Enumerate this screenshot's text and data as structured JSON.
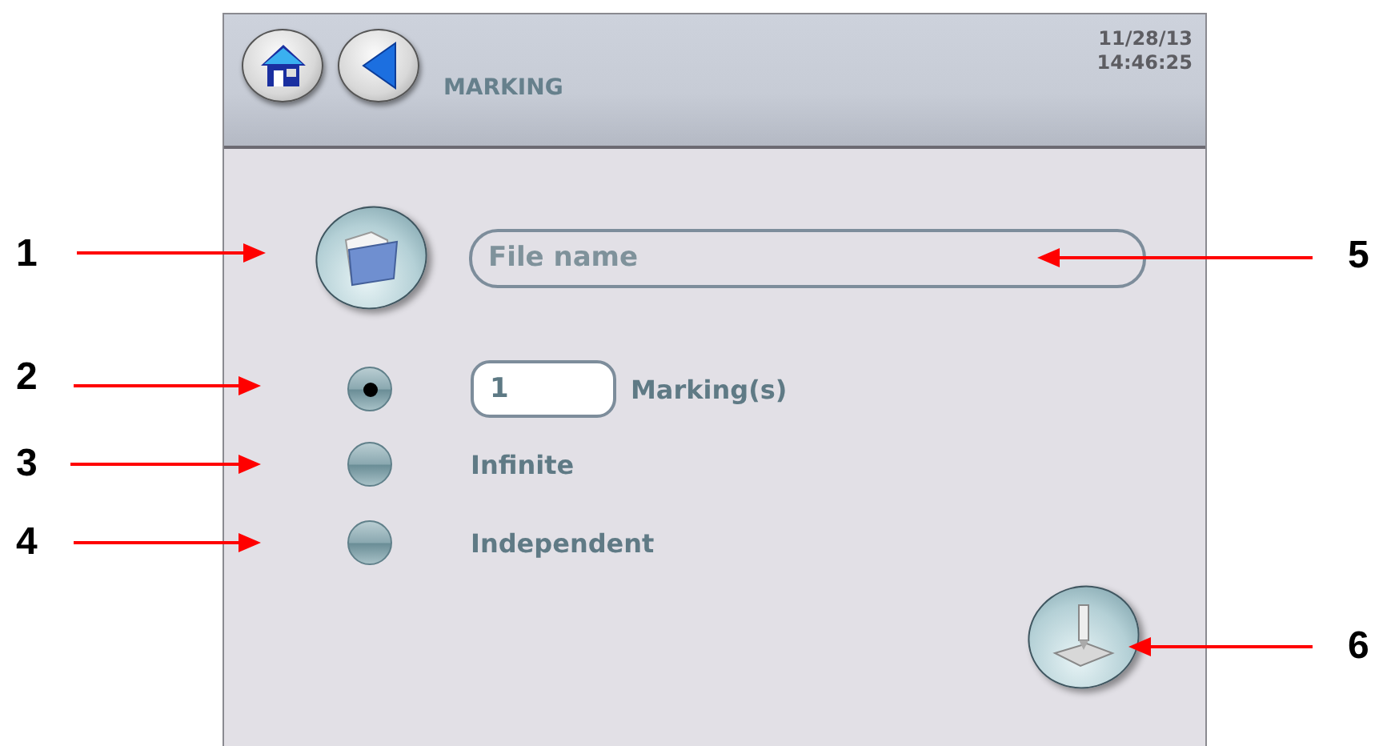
{
  "header": {
    "title": "MARKING",
    "date": "11/28/13",
    "time": "14:46:25"
  },
  "file_field": {
    "placeholder": "File name"
  },
  "modes": [
    {
      "kind": "count",
      "selected": true,
      "value": "1",
      "label": "Marking(s)"
    },
    {
      "kind": "plain",
      "selected": false,
      "label": "Infinite"
    },
    {
      "kind": "plain",
      "selected": false,
      "label": "Independent"
    }
  ],
  "callouts": [
    {
      "number": "1"
    },
    {
      "number": "2"
    },
    {
      "number": "3"
    },
    {
      "number": "4"
    },
    {
      "number": "5"
    },
    {
      "number": "6"
    }
  ]
}
